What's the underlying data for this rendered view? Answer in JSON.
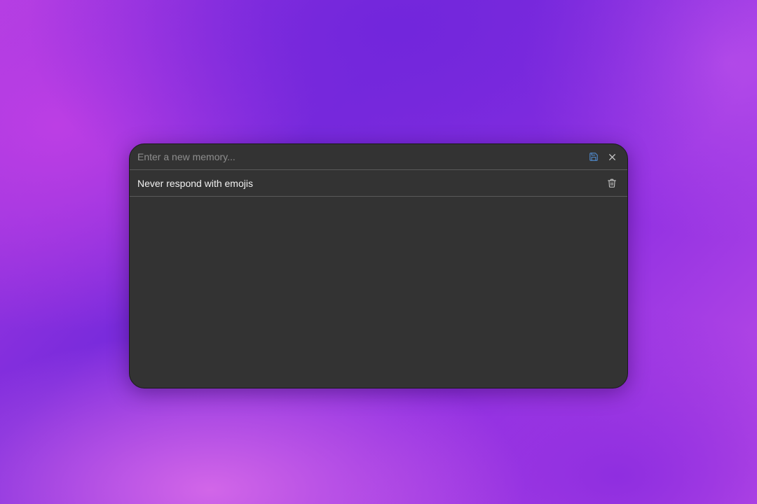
{
  "memory_editor": {
    "input": {
      "value": "",
      "placeholder": "Enter a new memory..."
    },
    "actions": {
      "save_icon": "save-icon",
      "close_icon": "close-icon"
    },
    "memories": [
      {
        "text": "Never respond with emojis",
        "delete_icon": "trash-icon"
      }
    ]
  },
  "colors": {
    "panel_bg": "#333333",
    "divider": "#5a5a5a",
    "save_icon": "#4f86c6",
    "close_icon": "#d0d0d0",
    "trash_icon": "#bdbdbd",
    "text": "#f2f2f2",
    "placeholder": "#8e8e8e"
  }
}
